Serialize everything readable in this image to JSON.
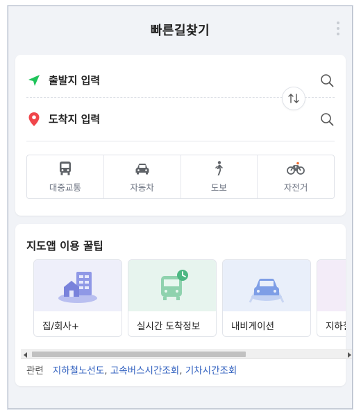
{
  "header": {
    "title": "빠른길찾기",
    "menu_icon": "more-vertical-icon"
  },
  "route": {
    "start_placeholder": "출발지 입력",
    "end_placeholder": "도착지 입력",
    "start_icon": "navigation-arrow-icon",
    "end_icon": "map-pin-icon",
    "swap_icon": "swap-arrows-icon",
    "start_color": "#1fc45a",
    "end_color": "#f0464b"
  },
  "modes": [
    {
      "label": "대중교통",
      "icon": "bus-icon"
    },
    {
      "label": "자동차",
      "icon": "car-icon"
    },
    {
      "label": "도보",
      "icon": "walk-icon"
    },
    {
      "label": "자전거",
      "icon": "bicycle-icon"
    }
  ],
  "tips": {
    "title": "지도앱 이용 꿀팁",
    "items": [
      {
        "label": "집/회사+",
        "icon": "home-office-icon",
        "bg": "#eeeffa"
      },
      {
        "label": "실시간 도착정보",
        "icon": "bus-clock-icon",
        "bg": "#e7f4ee"
      },
      {
        "label": "내비게이션",
        "icon": "car-navigation-icon",
        "bg": "#e9effa"
      },
      {
        "label": "지하철",
        "icon": "subway-icon",
        "bg": "#f3ecf8"
      }
    ]
  },
  "related": {
    "prefix": "관련",
    "links": [
      "지하철노선도",
      "고속버스시간조회",
      "기차시간조회"
    ]
  }
}
